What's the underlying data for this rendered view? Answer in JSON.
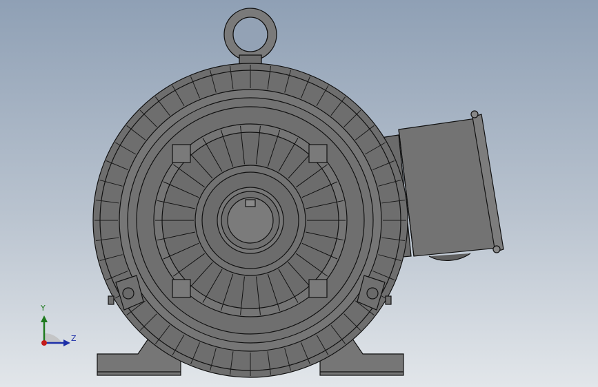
{
  "viewport": {
    "background_top": "#8fa0b5",
    "background_bottom": "#e2e6ea"
  },
  "model": {
    "shade_color": "#6f6f6f",
    "edge_color": "#111111"
  },
  "triad": {
    "y_label": "Y",
    "z_label": "Z",
    "y_color": "#1e7a1e",
    "z_color": "#1d2fa8",
    "x_color": "#c41a1a"
  }
}
